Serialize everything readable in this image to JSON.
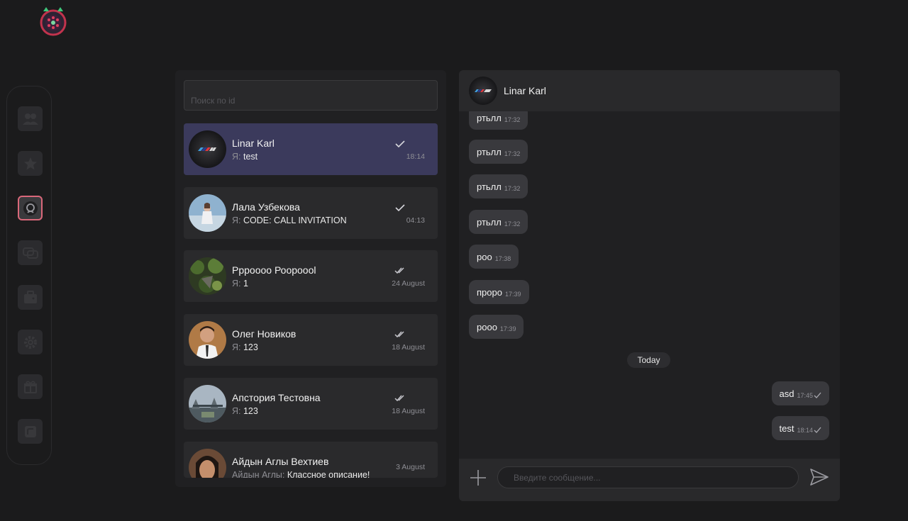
{
  "sidebar": {
    "items": [
      {
        "icon": "contacts-icon",
        "active": false
      },
      {
        "icon": "star-icon",
        "active": false
      },
      {
        "icon": "chat-bubble-icon",
        "active": true
      },
      {
        "icon": "messages-icon",
        "active": false
      },
      {
        "icon": "wallet-icon",
        "active": false
      },
      {
        "icon": "gear-icon",
        "active": false
      },
      {
        "icon": "gift-icon",
        "active": false
      },
      {
        "icon": "card-icon",
        "active": false
      }
    ]
  },
  "chat_list": {
    "search_placeholder": "Поиск по id",
    "chats": [
      {
        "name": "Linar Karl",
        "sender": "Я:",
        "preview": "test",
        "time": "18:14",
        "read": "single",
        "active": true
      },
      {
        "name": "Лала Узбекова",
        "sender": "Я:",
        "preview": "CODE: CALL INVITATION",
        "time": "04:13",
        "read": "single",
        "active": false
      },
      {
        "name": "Ррроооо Роороool",
        "sender": "Я:",
        "preview": "1",
        "time": "24 August",
        "read": "double",
        "active": false
      },
      {
        "name": "Олег Новиков",
        "sender": "Я:",
        "preview": "123",
        "time": "18 August",
        "read": "double",
        "active": false
      },
      {
        "name": "Апстория Тестовна",
        "sender": "Я:",
        "preview": "123",
        "time": "18 August",
        "read": "double",
        "active": false
      },
      {
        "name": "Айдын Аглы Вехтиев",
        "sender": "Айдын Аглы:",
        "preview": "Классное описание!",
        "time": "3 August",
        "read": "none",
        "active": false
      }
    ]
  },
  "conversation": {
    "name": "Linar Karl",
    "messages_in": [
      {
        "text": "ртьлл",
        "time": "17:32"
      },
      {
        "text": "ртьлл",
        "time": "17:32"
      },
      {
        "text": "ртьлл",
        "time": "17:32"
      },
      {
        "text": "ртьлл",
        "time": "17:32"
      },
      {
        "text": "роо",
        "time": "17:38"
      },
      {
        "text": "проро",
        "time": "17:39"
      },
      {
        "text": "рооо",
        "time": "17:39"
      }
    ],
    "date_divider": "Today",
    "messages_out": [
      {
        "text": "asd",
        "time": "17:45"
      },
      {
        "text": "test",
        "time": "18:14"
      }
    ],
    "input_placeholder": "Введите сообщение..."
  },
  "colors": {
    "background": "#1b1b1c",
    "panel": "#202022",
    "active_chat": "#3b3a5c",
    "active_rail_border": "#d9687a"
  }
}
